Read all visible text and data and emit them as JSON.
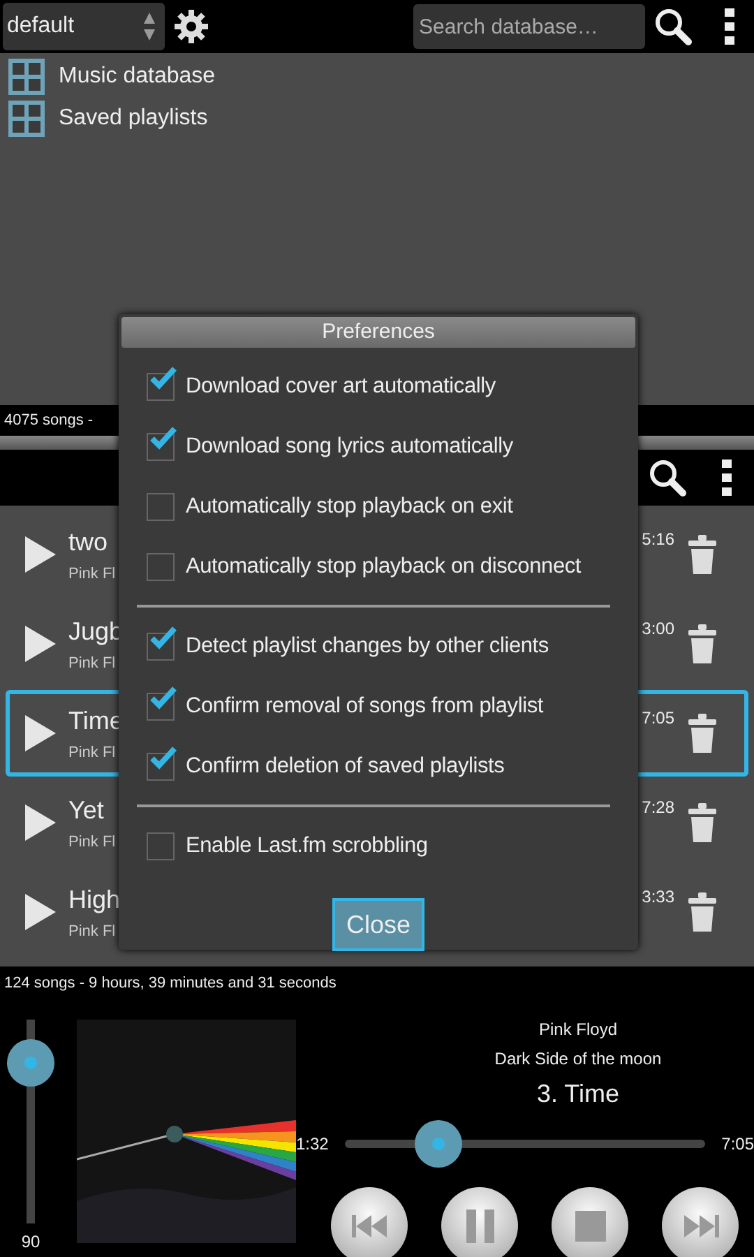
{
  "top_bar": {
    "profile": "default",
    "search": {
      "placeholder": "Search database…"
    }
  },
  "browser": {
    "items": [
      {
        "label": "Music database"
      },
      {
        "label": "Saved playlists"
      }
    ],
    "status": "4075 songs -"
  },
  "playlist": {
    "rows": [
      {
        "title": "two",
        "subtitle": "Pink Fl",
        "duration": "5:16",
        "selected": false
      },
      {
        "title": "Jugb",
        "subtitle": "Pink Fl",
        "duration": "3:00",
        "selected": false
      },
      {
        "title": "Time",
        "subtitle": "Pink Fl",
        "duration": "7:05",
        "selected": true
      },
      {
        "title": "Yet",
        "subtitle": "Pink Fl",
        "duration": "7:28",
        "selected": false
      },
      {
        "title": "High",
        "subtitle": "Pink Fl",
        "duration": "3:33",
        "selected": false
      }
    ],
    "status": "124 songs - 9 hours, 39 minutes and 31 seconds"
  },
  "player": {
    "volume": {
      "level": 0.79,
      "reading": "90"
    },
    "artist": "Pink Floyd",
    "album": "Dark Side of the moon",
    "track": "3. Time",
    "elapsed": "1:32",
    "total": "7:05",
    "seek": {
      "level": 0.26
    },
    "controls": [
      {
        "kind": "previous"
      },
      {
        "kind": "pause"
      },
      {
        "kind": "stop"
      },
      {
        "kind": "next"
      }
    ]
  },
  "dialog": {
    "title": "Preferences",
    "groups": [
      [
        {
          "label": "Download cover art automatically",
          "checked": true
        },
        {
          "label": "Download song lyrics automatically",
          "checked": true
        },
        {
          "label": "Automatically stop playback on exit",
          "checked": false
        },
        {
          "label": "Automatically stop playback on disconnect",
          "checked": false
        }
      ],
      [
        {
          "label": "Detect playlist changes by other clients",
          "checked": true
        },
        {
          "label": "Confirm removal of songs from playlist",
          "checked": true
        },
        {
          "label": "Confirm deletion of saved playlists",
          "checked": true
        }
      ],
      [
        {
          "label": "Enable Last.fm scrobbling",
          "checked": false
        }
      ]
    ],
    "button": "Close"
  }
}
